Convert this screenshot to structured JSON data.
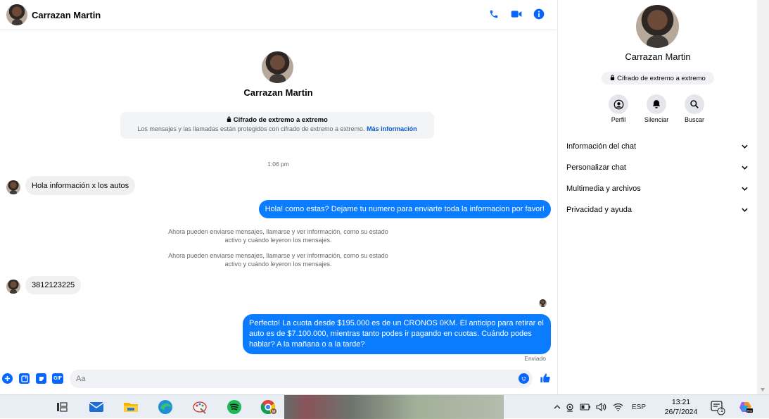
{
  "chat": {
    "contact_name": "Carrazan Martin",
    "encryption": {
      "title": "Cifrado de extremo a extremo",
      "description": "Los mensajes y las llamadas están protegidos con cifrado de extremo a extremo.",
      "link": "Más información"
    },
    "timestamp": "1:06 pm",
    "messages": [
      {
        "direction": "in",
        "text": "Hola información x los autos"
      },
      {
        "direction": "out",
        "text": "Hola! como estas? Dejame tu numero para enviarte toda la informacion por favor!"
      },
      {
        "direction": "system",
        "text": "Ahora pueden enviarse mensajes, llamarse y ver información, como su estado activo y cuándo leyeron los mensajes."
      },
      {
        "direction": "system",
        "text": "Ahora pueden enviarse mensajes, llamarse y ver información, como su estado activo y cuándo leyeron los mensajes."
      },
      {
        "direction": "in",
        "text": "3812123225"
      },
      {
        "direction": "out",
        "text": "Perfecto! La cuota desde $195.000 es de un CRONOS 0KM. El anticipo para retirar el auto es de $7.100.000, mientras tanto podes ir pagando en cuotas. Cuándo podes hablar? A la mañana o a la tarde?"
      }
    ],
    "sent_status": "Enviado",
    "composer_placeholder": "Aa"
  },
  "right_panel": {
    "name": "Carrazan Martin",
    "badge": "Cifrado de extremo a extremo",
    "actions": [
      {
        "label": "Perfil",
        "icon": "profile-icon"
      },
      {
        "label": "Silenciar",
        "icon": "bell-icon"
      },
      {
        "label": "Buscar",
        "icon": "search-icon"
      }
    ],
    "sections": [
      {
        "label": "Información del chat"
      },
      {
        "label": "Personalizar chat"
      },
      {
        "label": "Multimedia y archivos"
      },
      {
        "label": "Privacidad y ayuda"
      }
    ]
  },
  "taskbar": {
    "language": "ESP",
    "time": "13:21",
    "date": "26/7/2024",
    "notification_count": "1",
    "apps": [
      "task-view",
      "mail",
      "file-explorer",
      "edge",
      "paint",
      "spotify",
      "chrome"
    ]
  },
  "colors": {
    "accent": "#0a7cff",
    "header_icons": "#0866ff",
    "incoming_bubble": "#f0f0f0",
    "link": "#0a58ca"
  }
}
